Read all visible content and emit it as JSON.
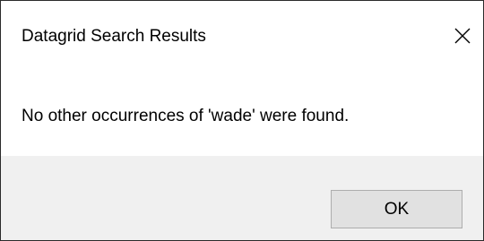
{
  "dialog": {
    "title": "Datagrid Search Results",
    "message": "No other occurrences of 'wade' were found.",
    "ok_label": "OK",
    "close_icon": "close-icon"
  },
  "colors": {
    "footer_background": "#f0f0f0",
    "button_background": "#e1e1e1",
    "button_border": "#adadad",
    "dialog_border": "#2b2b2b"
  }
}
